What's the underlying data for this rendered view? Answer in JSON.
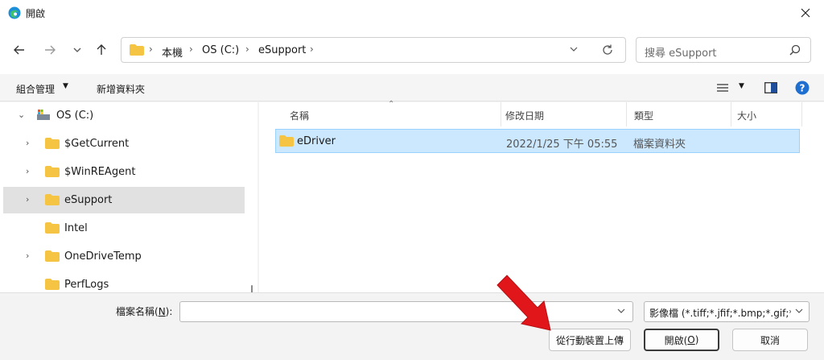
{
  "window": {
    "title": "開啟"
  },
  "address": {
    "crumbs": [
      "本機",
      "OS (C:)",
      "eSupport"
    ]
  },
  "search": {
    "placeholder": "搜尋 eSupport"
  },
  "commands": {
    "organize": "組合管理",
    "new_folder": "新增資料夾"
  },
  "sidebar": {
    "items": [
      {
        "label": "OS (C:)"
      },
      {
        "label": "$GetCurrent"
      },
      {
        "label": "$WinREAgent"
      },
      {
        "label": "eSupport"
      },
      {
        "label": "Intel"
      },
      {
        "label": "OneDriveTemp"
      },
      {
        "label": "PerfLogs"
      }
    ]
  },
  "columns": {
    "name": "名稱",
    "modified": "修改日期",
    "type": "類型",
    "size": "大小"
  },
  "files": [
    {
      "name": "eDriver",
      "modified": "2022/1/25 下午 05:55",
      "type": "檔案資料夾",
      "size": ""
    }
  ],
  "bottom": {
    "filename_label": "檔案名稱(N):",
    "filename_value": "",
    "filter_value": "影像檔 (*.tiff;*.jfif;*.bmp;*.gif;*",
    "mobile_upload": "從行動裝置上傳",
    "open": "開啟(O)",
    "cancel": "取消"
  },
  "colors": {
    "accent": "#0067c0",
    "folder": "#f6c443",
    "selection": "#cce8ff",
    "arrow": "#e0161b"
  }
}
